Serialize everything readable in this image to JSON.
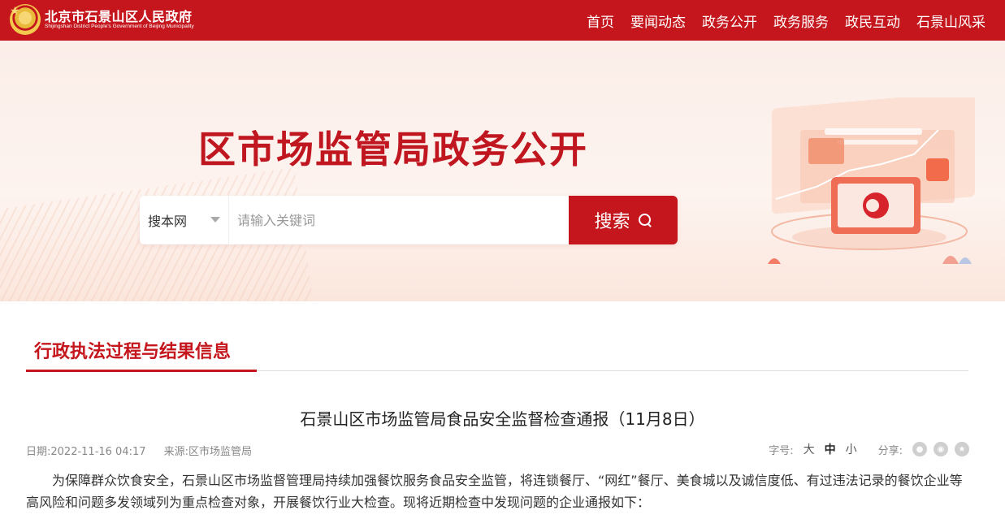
{
  "header": {
    "site_name": "北京市石景山区人民政府",
    "site_name_en": "Shijingshan District People's Government of Beijing Municipality",
    "nav": [
      "首页",
      "要闻动态",
      "政务公开",
      "政务服务",
      "政民互动",
      "石景山风采"
    ]
  },
  "banner": {
    "title": "区市场监管局政务公开",
    "search": {
      "scope": "搜本网",
      "placeholder": "请输入关键词",
      "button_label": "搜索"
    }
  },
  "section": {
    "title": "行政执法过程与结果信息"
  },
  "article": {
    "title": "石景山区市场监管局食品安全监督检查通报（11月8日）",
    "date": "日期:2022-11-16 04:17",
    "source": "来源:区市场监管局",
    "font_size_label": "字号:",
    "font_sizes": [
      "大",
      "中",
      "小"
    ],
    "share_label": "分享:",
    "share_icons": [
      "wechat-icon",
      "weibo-icon",
      "favorite-icon"
    ],
    "body": "为保障群众饮食安全，石景山区市场监督管理局持续加强餐饮服务食品安全监管，将连锁餐厅、“网红”餐厅、美食城以及诚信度低、有过违法记录的餐饮企业等高风险和问题多发领域列为重点检查对象，开展餐饮行业大检查。现将近期检查中发现问题的企业通报如下："
  },
  "colors": {
    "brand_red": "#c4161c",
    "banner_bg": "#fbeee9"
  }
}
